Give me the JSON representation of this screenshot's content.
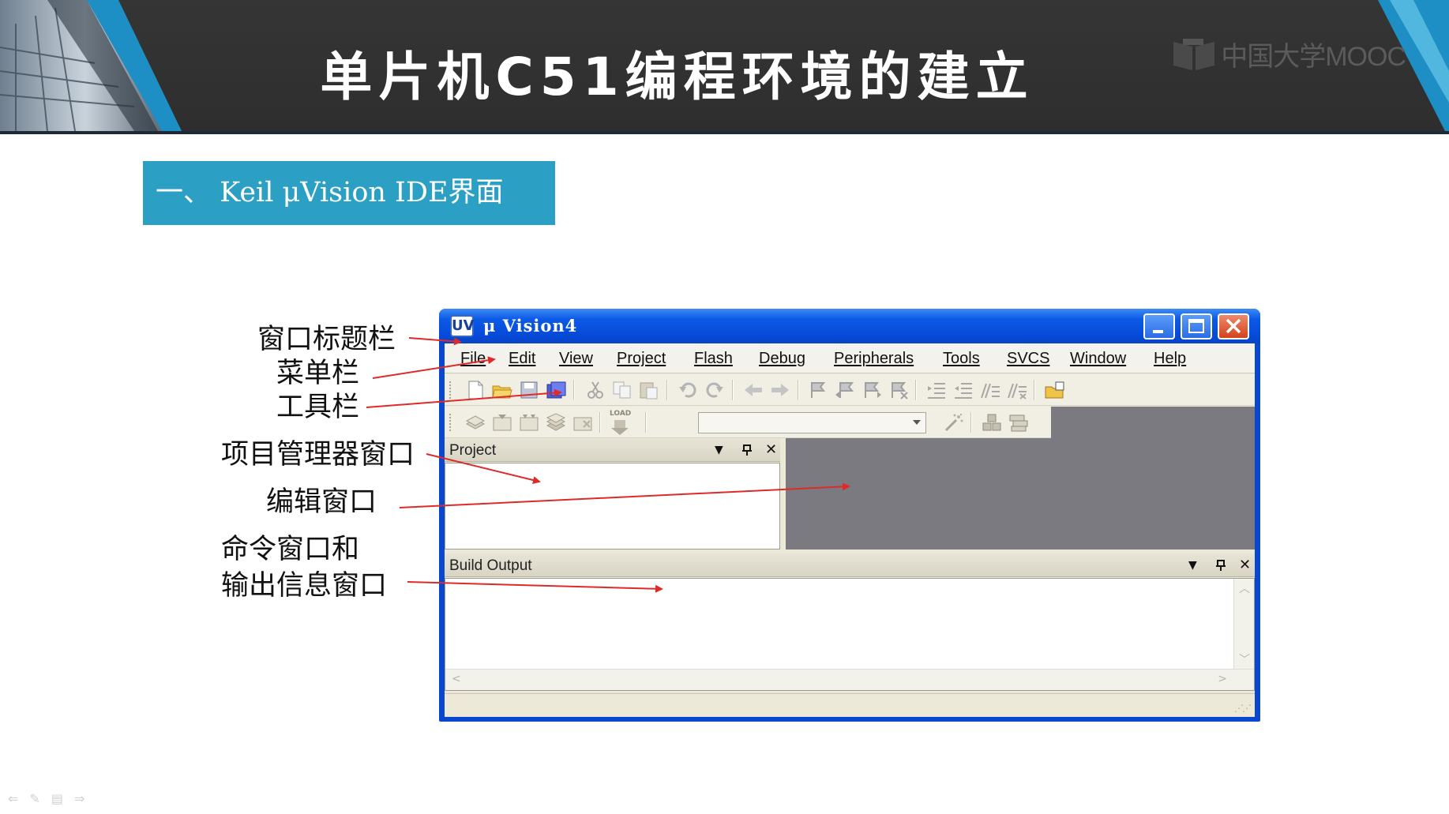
{
  "slide": {
    "title": "单片机C51编程环境的建立",
    "logo_text": "中国大学MOOC",
    "section_heading": "一、 Keil μVision IDE界面"
  },
  "callouts": [
    {
      "id": "title-bar",
      "text": "窗口标题栏"
    },
    {
      "id": "menu-bar",
      "text": "菜单栏"
    },
    {
      "id": "toolbar",
      "text": "工具栏"
    },
    {
      "id": "project-window",
      "text": "项目管理器窗口"
    },
    {
      "id": "editor-window",
      "text": "编辑窗口"
    },
    {
      "id": "command-output",
      "line1": "命令窗口和",
      "line2": "输出信息窗口"
    }
  ],
  "window": {
    "title": "μ Vision4",
    "app_icon": "UV",
    "menu": [
      "File",
      "Edit",
      "View",
      "Project",
      "Flash",
      "Debug",
      "Peripherals",
      "Tools",
      "SVCS",
      "Window",
      "Help"
    ],
    "project_panel_title": "Project",
    "build_panel_title": "Build Output",
    "panel_controls": {
      "dropdown": "▼",
      "pin": "ᵖ",
      "close": "✕"
    },
    "load_button_label": "LOAD",
    "target_select_value": ""
  },
  "colors": {
    "banner": "#333333",
    "section_box": "#2ba0c4",
    "xp_titlebar": "#0b5ae6",
    "arrow": "#e02a2a",
    "editor_bg": "#7b7a80"
  },
  "icons": {
    "toolbar1": [
      "new-file-icon",
      "open-folder-icon",
      "save-icon",
      "save-all-icon",
      "cut-icon",
      "copy-icon",
      "paste-icon",
      "undo-icon",
      "redo-icon",
      "nav-back-icon",
      "nav-forward-icon",
      "bookmark-icon",
      "bookmark-prev-icon",
      "bookmark-next-icon",
      "bookmark-clear-icon",
      "indent-icon",
      "unindent-icon",
      "comment-icon",
      "uncomment-icon",
      "find-in-files-icon"
    ],
    "toolbar2": [
      "translate-icon",
      "build-icon",
      "rebuild-icon",
      "batch-build-icon",
      "stop-build-icon",
      "load-icon",
      "target-options-icon",
      "manage-components-icon",
      "select-packs-icon"
    ]
  }
}
